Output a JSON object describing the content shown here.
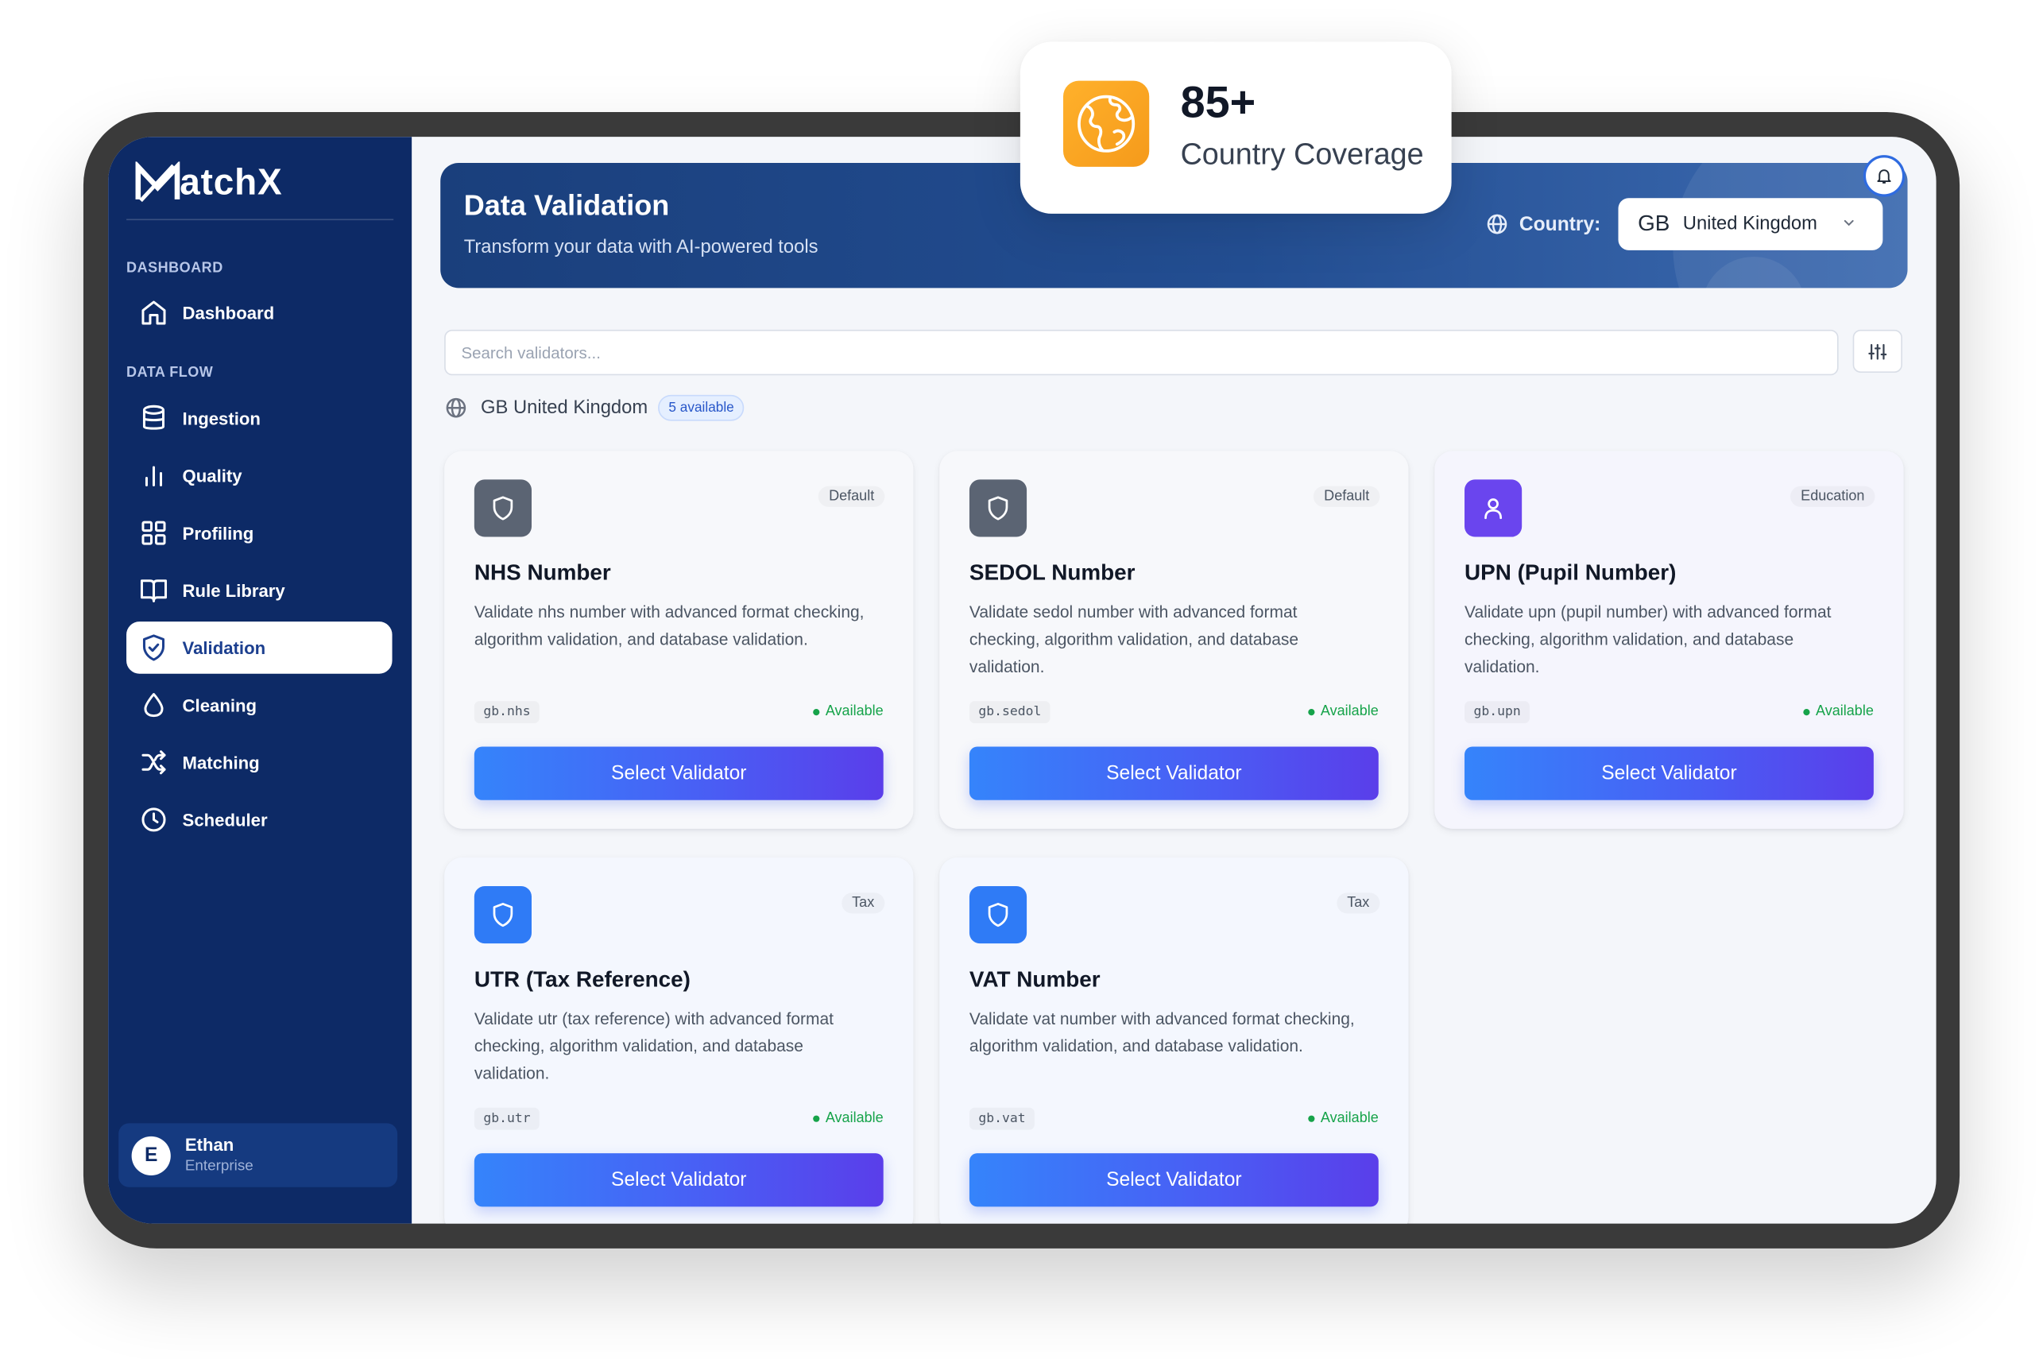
{
  "brand": {
    "name": "atchX"
  },
  "sidebar": {
    "sections": {
      "dashboard": "DASHBOARD",
      "data_flow": "DATA FLOW"
    },
    "items": [
      {
        "label": "Dashboard",
        "icon": "home-icon"
      },
      {
        "label": "Ingestion",
        "icon": "database-icon"
      },
      {
        "label": "Quality",
        "icon": "bar-chart-icon"
      },
      {
        "label": "Profiling",
        "icon": "grid-icon"
      },
      {
        "label": "Rule Library",
        "icon": "book-icon"
      },
      {
        "label": "Validation",
        "icon": "shield-check-icon",
        "active": true
      },
      {
        "label": "Cleaning",
        "icon": "droplet-icon"
      },
      {
        "label": "Matching",
        "icon": "shuffle-icon"
      },
      {
        "label": "Scheduler",
        "icon": "clock-icon"
      }
    ],
    "user": {
      "initial": "E",
      "name": "Ethan",
      "plan": "Enterprise"
    }
  },
  "header": {
    "title": "Data Validation",
    "subtitle": "Transform your data with AI-powered tools",
    "country_label": "Country:",
    "country_code": "GB",
    "country_name": "United Kingdom"
  },
  "search": {
    "placeholder": "Search validators..."
  },
  "region": {
    "label": "GB United Kingdom",
    "badge": "5 available"
  },
  "validators": [
    {
      "title": "NHS Number",
      "category": "Default",
      "description": "Validate nhs number with advanced format checking, algorithm validation, and database validation.",
      "code": "gb.nhs",
      "status": "Available",
      "button": "Select Validator",
      "icon": "shield-icon",
      "icon_color": "#5b6473"
    },
    {
      "title": "SEDOL Number",
      "category": "Default",
      "description": "Validate sedol number with advanced format checking, algorithm validation, and database validation.",
      "code": "gb.sedol",
      "status": "Available",
      "button": "Select Validator",
      "icon": "shield-icon",
      "icon_color": "#5b6473"
    },
    {
      "title": "UPN (Pupil Number)",
      "category": "Education",
      "description": "Validate upn (pupil number) with advanced format checking, algorithm validation, and database validation.",
      "code": "gb.upn",
      "status": "Available",
      "button": "Select Validator",
      "icon": "user-icon",
      "icon_color": "#6a45ee"
    },
    {
      "title": "UTR (Tax Reference)",
      "category": "Tax",
      "description": "Validate utr (tax reference) with advanced format checking, algorithm validation, and database validation.",
      "code": "gb.utr",
      "status": "Available",
      "button": "Select Validator",
      "icon": "shield-icon",
      "icon_color": "#2f7bf6"
    },
    {
      "title": "VAT Number",
      "category": "Tax",
      "description": "Validate vat number with advanced format checking, algorithm validation, and database validation.",
      "code": "gb.vat",
      "status": "Available",
      "button": "Select Validator",
      "icon": "shield-icon",
      "icon_color": "#2f7bf6"
    }
  ],
  "coverage": {
    "value": "85+",
    "label": "Country Coverage",
    "icon": "globe-icon"
  },
  "colors": {
    "sidebar": "#0d2a66",
    "accent": "#3584fb",
    "available": "#16a34a",
    "coverage_icon": "#f59a1b"
  }
}
